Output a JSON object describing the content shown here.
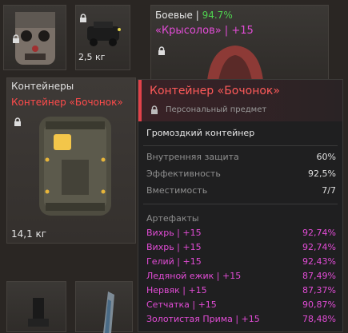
{
  "top_slot_weight": "2,5 кг",
  "character": {
    "label": "Боевые",
    "separator": "|",
    "percent": "94.7%",
    "name": "«Крысолов» | +15"
  },
  "containers": {
    "heading": "Контейнеры",
    "item_name": "Контейнер «Бочонок»",
    "weight": "14,1 кг"
  },
  "tooltip": {
    "title": "Контейнер «Бочонок»",
    "subtitle": "Персональный предмет",
    "description": "Громоздкий контейнер",
    "stats": [
      {
        "label": "Внутренняя защита",
        "value": "60%"
      },
      {
        "label": "Эффективность",
        "value": "92,5%"
      },
      {
        "label": "Вместимость",
        "value": "7/7"
      }
    ],
    "artifacts_heading": "Артефакты",
    "artifacts": [
      {
        "label": "Вихрь | +15",
        "value": "92,74%"
      },
      {
        "label": "Вихрь | +15",
        "value": "92,74%"
      },
      {
        "label": "Гелий | +15",
        "value": "92,43%"
      },
      {
        "label": "Ледяной ежик | +15",
        "value": "87,49%"
      },
      {
        "label": "Нервяк | +15",
        "value": "87,37%"
      },
      {
        "label": "Сетчатка | +15",
        "value": "90,87%"
      },
      {
        "label": "Золотистая Прима | +15",
        "value": "78,48%"
      }
    ]
  },
  "colors": {
    "accent_red": "#ff4b4b",
    "green": "#4fd24f",
    "artifact_pink": "#e24cd6"
  }
}
